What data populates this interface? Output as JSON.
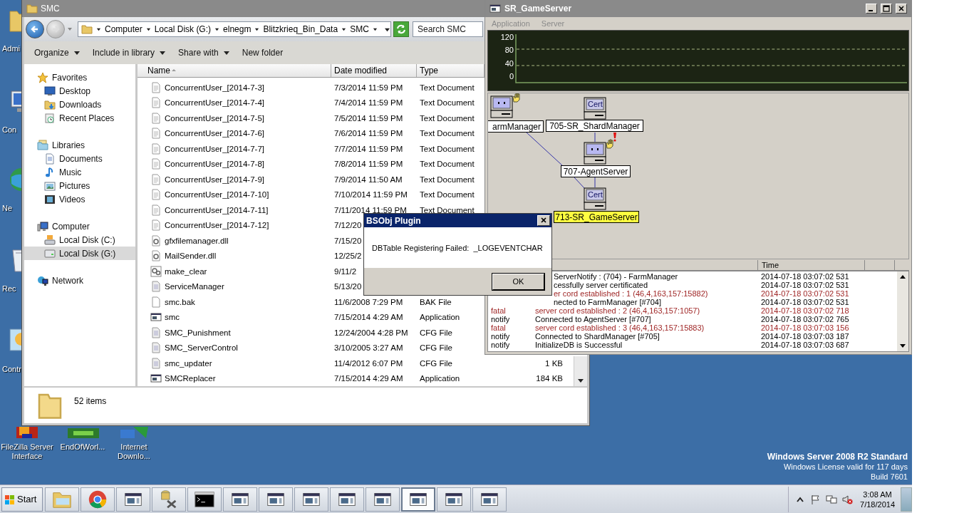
{
  "desktop": {
    "icons": [
      {
        "label": "Admi",
        "kind": "folder"
      },
      {
        "label": "Con",
        "kind": "computer"
      },
      {
        "label": "Ne",
        "kind": "network"
      },
      {
        "label": "Rec",
        "kind": "recycle"
      },
      {
        "label": "Contr",
        "kind": "control"
      }
    ],
    "shortcuts": [
      {
        "label": "FileZilla Server Interface",
        "kind": "filezilla"
      },
      {
        "label": "EndOfWorl...",
        "kind": "game"
      },
      {
        "label": "Internet Downlo...",
        "kind": "download"
      }
    ],
    "os_info": [
      "Windows Server 2008 R2 Standard",
      "Windows License valid for 117 days",
      "Build 7601"
    ]
  },
  "explorer": {
    "title": "SMC",
    "breadcrumb": [
      "Computer",
      "Local Disk (G:)",
      "elnegm",
      "Blitzkrieq_Bin_Data",
      "SMC"
    ],
    "search": {
      "placeholder": "Search SMC"
    },
    "toolbar": [
      {
        "label": "Organize",
        "menu": true
      },
      {
        "label": "Include in library",
        "menu": true
      },
      {
        "label": "Share with",
        "menu": true
      },
      {
        "label": "New folder",
        "menu": false
      }
    ],
    "sidebar": [
      {
        "label": "Favorites",
        "kind": "star",
        "selected": false,
        "children": [
          {
            "label": "Desktop",
            "kind": "desktop",
            "selected": false
          },
          {
            "label": "Downloads",
            "kind": "downloads",
            "selected": false
          },
          {
            "label": "Recent Places",
            "kind": "recent",
            "selected": false
          }
        ]
      },
      {
        "label": "Libraries",
        "kind": "library",
        "selected": false,
        "children": [
          {
            "label": "Documents",
            "kind": "documents",
            "selected": false
          },
          {
            "label": "Music",
            "kind": "music",
            "selected": false
          },
          {
            "label": "Pictures",
            "kind": "pictures",
            "selected": false
          },
          {
            "label": "Videos",
            "kind": "videos",
            "selected": false
          }
        ]
      },
      {
        "label": "Computer",
        "kind": "computer",
        "selected": false,
        "children": [
          {
            "label": "Local Disk (C:)",
            "kind": "disk-c",
            "selected": false
          },
          {
            "label": "Local Disk (G:)",
            "kind": "disk-g",
            "selected": true
          }
        ]
      },
      {
        "label": "Network",
        "kind": "network",
        "selected": false
      }
    ],
    "columns": [
      "Name",
      "Date modified",
      "Type"
    ],
    "files": [
      {
        "name": "ConcurrentUser_[2014-7-3]",
        "date": "7/3/2014 11:59 PM",
        "type": "Text Document",
        "kind": "text"
      },
      {
        "name": "ConcurrentUser_[2014-7-4]",
        "date": "7/4/2014 11:59 PM",
        "type": "Text Document",
        "kind": "text"
      },
      {
        "name": "ConcurrentUser_[2014-7-5]",
        "date": "7/5/2014 11:59 PM",
        "type": "Text Document",
        "kind": "text"
      },
      {
        "name": "ConcurrentUser_[2014-7-6]",
        "date": "7/6/2014 11:59 PM",
        "type": "Text Document",
        "kind": "text"
      },
      {
        "name": "ConcurrentUser_[2014-7-7]",
        "date": "7/7/2014 11:59 PM",
        "type": "Text Document",
        "kind": "text"
      },
      {
        "name": "ConcurrentUser_[2014-7-8]",
        "date": "7/8/2014 11:59 PM",
        "type": "Text Document",
        "kind": "text"
      },
      {
        "name": "ConcurrentUser_[2014-7-9]",
        "date": "7/9/2014 11:50 AM",
        "type": "Text Document",
        "kind": "text"
      },
      {
        "name": "ConcurrentUser_[2014-7-10]",
        "date": "7/10/2014 11:59 PM",
        "type": "Text Document",
        "kind": "text"
      },
      {
        "name": "ConcurrentUser_[2014-7-11]",
        "date": "7/11/2014 11:59 PM",
        "type": "Text Document",
        "kind": "text"
      },
      {
        "name": "ConcurrentUser_[2014-7-12]",
        "date": "7/12/20",
        "kind": "text"
      },
      {
        "name": "gfxfilemanager.dll",
        "date": "7/15/20",
        "kind": "dll"
      },
      {
        "name": "MailSender.dll",
        "date": "12/25/2",
        "kind": "dll"
      },
      {
        "name": "make_clear",
        "date": "9/11/2",
        "kind": "batch"
      },
      {
        "name": "ServiceManager",
        "date": "5/13/20",
        "kind": "cfg"
      },
      {
        "name": "smc.bak",
        "date": "11/6/2008 7:29 PM",
        "type": "BAK File",
        "kind": "blank"
      },
      {
        "name": "smc",
        "date": "7/15/2014 4:29 AM",
        "type": "Application",
        "kind": "app"
      },
      {
        "name": "SMC_Punishment",
        "date": "12/24/2004 4:28 PM",
        "type": "CFG File",
        "kind": "cfg"
      },
      {
        "name": "SMC_ServerControl",
        "date": "3/10/2005 3:27 AM",
        "type": "CFG File",
        "kind": "cfg"
      },
      {
        "name": "smc_updater",
        "date": "11/4/2012 6:07 PM",
        "type": "CFG File",
        "size": "1 KB",
        "kind": "cfg"
      },
      {
        "name": "SMCReplacer",
        "date": "7/15/2014 4:29 AM",
        "type": "Application",
        "size": "184 KB",
        "kind": "app"
      }
    ],
    "status": "52 items"
  },
  "game_server": {
    "title": "SR_GameServer",
    "menu": [
      "Application",
      "Server"
    ],
    "monitor": {
      "ticks": [
        "120",
        "80",
        "40",
        "0"
      ]
    },
    "nodes": [
      {
        "label": "armManager",
        "waving": true,
        "alert": false,
        "selected": false
      },
      {
        "label": "705-SR_ShardManager",
        "badge": "Cert",
        "waving": false,
        "alert": false,
        "selected": false
      },
      {
        "label": "707-AgentServer",
        "waving": true,
        "alert": true,
        "selected": false
      },
      {
        "label": "713-SR_GameServer",
        "badge": "Cert",
        "waving": false,
        "alert": false,
        "selected": true
      }
    ],
    "log_columns": [
      "Time"
    ],
    "log": [
      {
        "kind": "notify",
        "message": "ServerNotify : (704) - FarmManager",
        "time": "2014-07-18 03:07:02 531"
      },
      {
        "kind": "notify",
        "message": "cessfully server certificated",
        "time": "2014-07-18 03:07:02 531"
      },
      {
        "kind": "fatal",
        "message": "er cord established : 1 (46,4,163,157:15882)",
        "time": "2014-07-18 03:07:02 531"
      },
      {
        "kind": "notify",
        "message": "nected to FarmManager [#704]",
        "time": "2014-07-18 03:07:02 531"
      },
      {
        "kind": "fatal",
        "level": "fatal",
        "message": "server cord established : 2 (46,4,163,157:1057)",
        "time": "2014-07-18 03:07:02 718"
      },
      {
        "kind": "notify",
        "level": "notify",
        "message": "Connected to AgentServer [#707]",
        "time": "2014-07-18 03:07:02 765"
      },
      {
        "kind": "fatal",
        "level": "fatal",
        "message": "server cord established : 3 (46,4,163,157:15883)",
        "time": "2014-07-18 03:07:03 156"
      },
      {
        "kind": "notify",
        "level": "notify",
        "message": "Connected to ShardManager [#705]",
        "time": "2014-07-18 03:07:03 187"
      },
      {
        "kind": "notify",
        "level": "notify",
        "message": "InitializeDB is Successful",
        "time": "2014-07-18 03:07:03 687"
      }
    ]
  },
  "dialog": {
    "title": "BSObj Plugin",
    "message": "DBTable Registering Failed:  _LOGEVENTCHAR",
    "button": "OK"
  },
  "taskbar": {
    "start": "Start",
    "buttons": [
      {
        "kind": "folder",
        "selected": false
      },
      {
        "kind": "chrome",
        "selected": false
      },
      {
        "kind": "appwin",
        "selected": false
      },
      {
        "kind": "tool",
        "selected": false
      },
      {
        "kind": "cmd",
        "selected": false
      },
      {
        "kind": "appwin",
        "selected": false
      },
      {
        "kind": "appwin",
        "selected": false
      },
      {
        "kind": "appwin",
        "selected": false
      },
      {
        "kind": "appwin",
        "selected": false
      },
      {
        "kind": "appwin",
        "selected": false
      },
      {
        "kind": "appwin",
        "selected": true
      },
      {
        "kind": "appwin",
        "selected": false
      },
      {
        "kind": "appwin",
        "selected": false
      }
    ],
    "tray": [
      {
        "kind": "chevron"
      },
      {
        "kind": "flag"
      },
      {
        "kind": "network"
      },
      {
        "kind": "speaker-muted"
      }
    ],
    "time": "3:08 AM",
    "date": "7/18/2014"
  }
}
